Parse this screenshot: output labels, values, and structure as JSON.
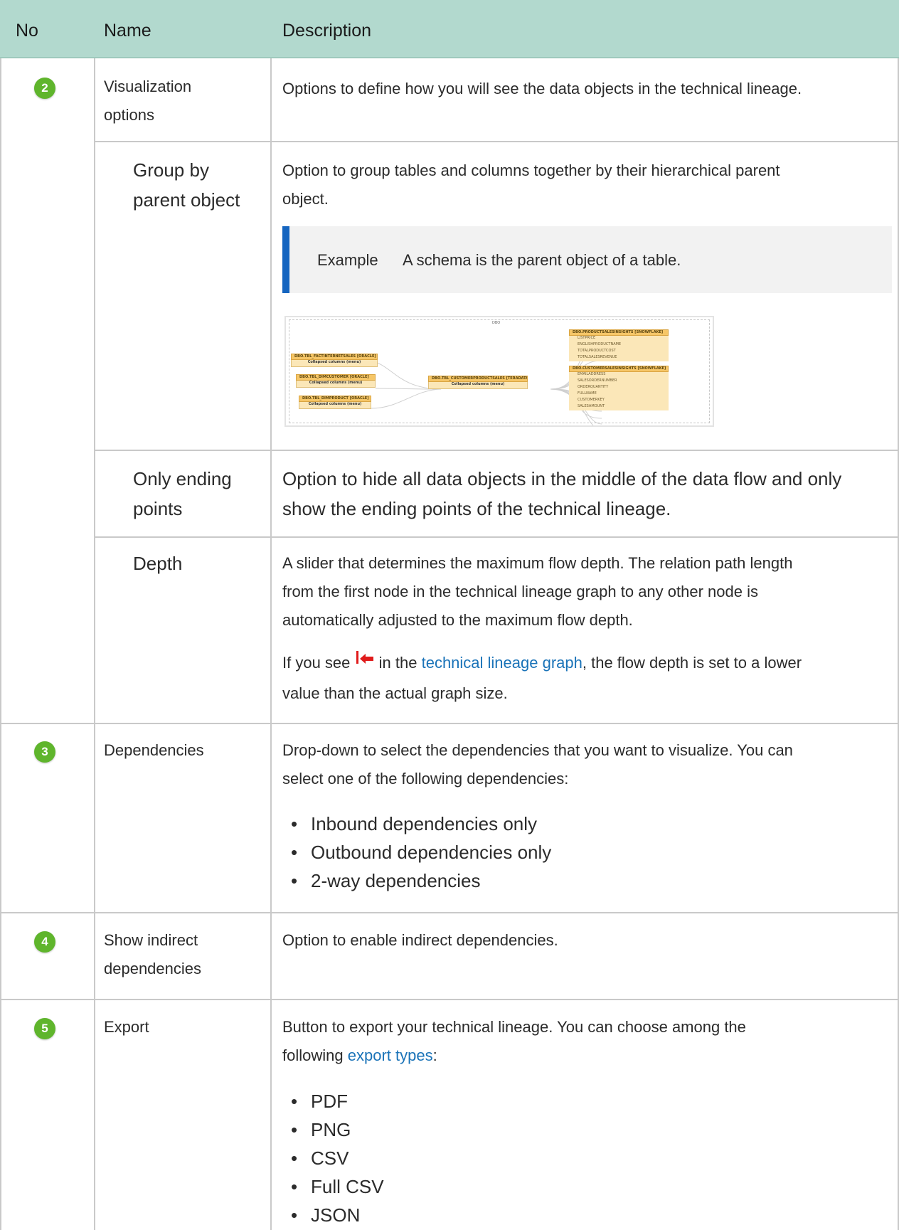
{
  "header": {
    "no": "No",
    "name": "Name",
    "description": "Description"
  },
  "rows": {
    "visualization": {
      "badge": "2",
      "name_line1": "Visualization",
      "name_line2": "options",
      "description": "Options to define how you will see the data objects in the technical lineage."
    },
    "group": {
      "name_line1": "Group by",
      "name_line2": "parent object",
      "description_line1": "Option to group tables and columns together by their hierarchical parent",
      "description_line2": "object.",
      "note_label": "Example",
      "note_text": "A schema is the parent object of a table."
    },
    "ending": {
      "name_line1": "Only ending",
      "name_line2": "points",
      "description_line1": "Option to hide all data objects in the middle of the data flow and only",
      "description_line2": "show the ending points of the technical lineage."
    },
    "depth": {
      "name": "Depth",
      "description_line1": "A slider that determines the maximum flow depth. The relation path length",
      "description_line2": "from the first node in the technical lineage graph to any other node is",
      "description_line3": "automatically adjusted to the maximum flow depth.",
      "line4_before": "If you see",
      "line4_mid": "in the",
      "line4_link": "technical lineage graph",
      "line4_after": ", the flow depth is set to a lower",
      "line5": "value than the actual graph size."
    },
    "dependencies": {
      "badge": "3",
      "name": "Dependencies",
      "description_line1": "Drop-down to select the dependencies that you want to visualize. You can",
      "description_line2": "select one of the following dependencies:",
      "items": [
        "Inbound dependencies only",
        "Outbound dependencies only",
        "2-way dependencies"
      ]
    },
    "indirect": {
      "badge": "4",
      "name_line1": "Show indirect",
      "name_line2": "dependencies",
      "description": "Option to enable indirect dependencies."
    },
    "export": {
      "badge": "5",
      "name": "Export",
      "description_line1": "Button to export your technical lineage. You can choose among the",
      "line2_before": "following",
      "line2_link": "export types",
      "line2_after": ":",
      "items": [
        "PDF",
        "PNG",
        "CSV",
        "Full CSV",
        "JSON"
      ]
    }
  },
  "diagram": {
    "group_title": "DBO",
    "src1": {
      "title": "DBO.TBL_FACTINTERNETSALES [ORACLE]",
      "body": "Collapsed columns (menu)"
    },
    "src2": {
      "title": "DBO.TBL_DIMCUSTOMER [ORACLE]",
      "body": "Collapsed columns (menu)"
    },
    "src3": {
      "title": "DBO.TBL_DIMPRODUCT [ORACLE]",
      "body": "Collapsed columns (menu)"
    },
    "mid": {
      "title": "DBO.TBL_CUSTOMERPRODUCTSALES [TERADATA]",
      "body": "Collapsed columns (menu)"
    },
    "tgt1": {
      "title": "DBO.PRODUCTSALESINSIGHTS [SNOWFLAKE]",
      "columns": [
        "LISTPRICE",
        "ENGLISHPRODUCTNAME",
        "TOTALPRODUCTCOST",
        "TOTALSALESREVENUE"
      ]
    },
    "tgt2": {
      "title": "DBO.CUSTOMERSALESINSIGHTS [SNOWFLAKE]",
      "columns": [
        "EMAILADDRESS",
        "SALESORDERNUMBER",
        "ORDERQUANTITY",
        "FULLNAME",
        "CUSTOMERKEY",
        "SALESAMOUNT"
      ]
    }
  },
  "colors": {
    "header_bg": "#b2d9ce",
    "badge": "#5fb52c",
    "link": "#1a73b8",
    "note_bar": "#1565c0",
    "grid": "#c9c9c9"
  }
}
